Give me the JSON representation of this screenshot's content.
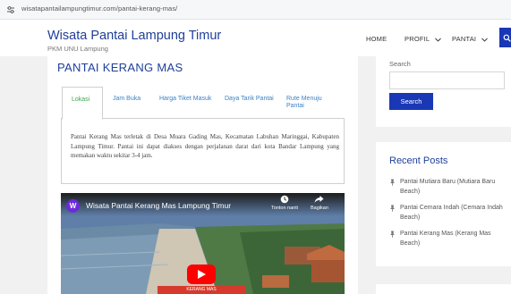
{
  "browser": {
    "url": "wisatapantailampungtimur.com/pantai-kerang-mas/"
  },
  "header": {
    "site_title": "Wisata Pantai Lampung Timur",
    "site_description": "PKM UNU Lampung",
    "nav": [
      {
        "label": "HOME",
        "has_dropdown": false
      },
      {
        "label": "PROFIL",
        "has_dropdown": true
      },
      {
        "label": "PANTAI",
        "has_dropdown": true
      }
    ],
    "search_icon": "search-icon"
  },
  "main": {
    "post_title": "PANTAI KERANG MAS",
    "tabs": [
      {
        "label": "Lokasi",
        "active": true
      },
      {
        "label": "Jam Buka",
        "active": false
      },
      {
        "label": "Harga Tiket Masuk",
        "active": false
      },
      {
        "label": "Daya Tarik Pantai",
        "active": false
      },
      {
        "label": "Rute Menuju Pantai",
        "active": false
      }
    ],
    "tab_content": "Pantai Kerang Mas terletak di Desa Muara Gading Mas, Kecamatan Labuhan Maringgai, Kabupaten Lampung Timur. Pantai ini dapat diakses dengan perjalanan darat dari kota Bandar Lampung yang memakan waktu sekitar 3-4 jam.",
    "video": {
      "channel_initial": "W",
      "title": "Wisata Pantai Kerang Mas Lampung Timur",
      "watch_later_label": "Tonton nanti",
      "share_label": "Bagikan",
      "caption": "KERANG MAS"
    }
  },
  "sidebar": {
    "search_label": "Search",
    "search_button": "Search",
    "recent_posts_title": "Recent Posts",
    "recent_posts": [
      "Pantai Mutiara Baru (Mutiara Baru Beach)",
      "Pantai Cemara Indah (Cemara Indah Beach)",
      "Pantai Kerang Mas (Kerang Mas Beach)"
    ]
  },
  "colors": {
    "brand_blue": "#1f3f9a",
    "button_blue": "#1a37b5",
    "tab_active_green": "#3aa64a",
    "tab_link_blue": "#3b82c4",
    "youtube_red": "#ff0000"
  }
}
